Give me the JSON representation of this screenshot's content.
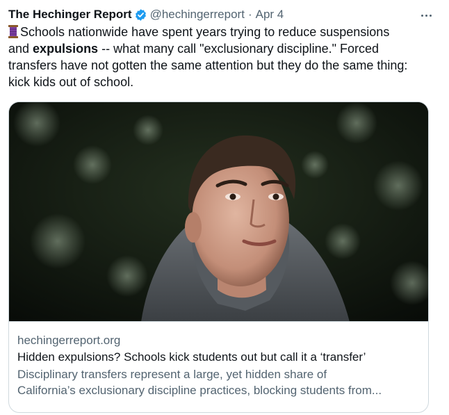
{
  "tweet": {
    "display_name": "The Hechinger Report",
    "handle": "@hechingerreport",
    "separator": "·",
    "date": "Apr 4",
    "verified_color": "#1d9bf0",
    "text_lines": {
      "l1": "Schools nationwide have spent years trying to reduce suspensions",
      "l2_pre": "and ",
      "l2_bold": "expulsions",
      "l2_post": " -- what many call \"exclusionary discipline.\" Forced",
      "l3": "transfers have not gotten the same attention but they do the same thing:",
      "l4": "kick kids out of school."
    },
    "leading_emoji": "thread-spool-icon"
  },
  "card": {
    "domain": "hechingerreport.org",
    "title": "Hidden expulsions? Schools kick students out but call it a ‘transfer’",
    "description_line1": "Disciplinary transfers represent a large, yet hidden share of",
    "description_line2": "California’s exclusionary discipline practices, blocking students from...",
    "image": "portrait-of-teen-in-gray-hoodie"
  },
  "colors": {
    "text": "#0f1419",
    "secondary": "#536471",
    "border": "#cfd9de",
    "accent": "#1d9bf0"
  }
}
